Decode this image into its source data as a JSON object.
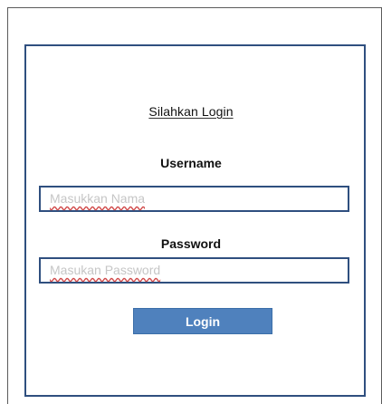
{
  "login_form": {
    "title": "Silahkan Login",
    "username_label": "Username",
    "username_placeholder": "Masukkan Nama",
    "password_label": "Password",
    "password_placeholder": "Masukan Password",
    "login_button_label": "Login"
  },
  "colors": {
    "panel_border": "#2f4f7f",
    "button_fill": "#4f81bd",
    "placeholder_text": "#c6c6c6"
  }
}
